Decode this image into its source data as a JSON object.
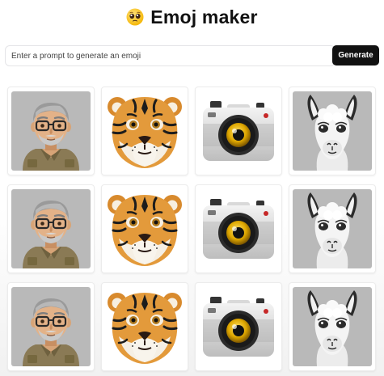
{
  "app": {
    "title": "Emoj maker",
    "title_icon": "pleading-face-emoji"
  },
  "prompt": {
    "placeholder": "Enter a prompt to generate an emoji",
    "value": ""
  },
  "generate_label": "Generate",
  "colors": {
    "button_bg": "#111111",
    "button_text": "#ffffff",
    "border": "#e4e4e7",
    "tile_gray_bg": "#b9b9b9"
  },
  "grid": {
    "columns": [
      "man-with-glasses",
      "tiger-face",
      "camera",
      "llama-face"
    ],
    "rows": 3
  }
}
